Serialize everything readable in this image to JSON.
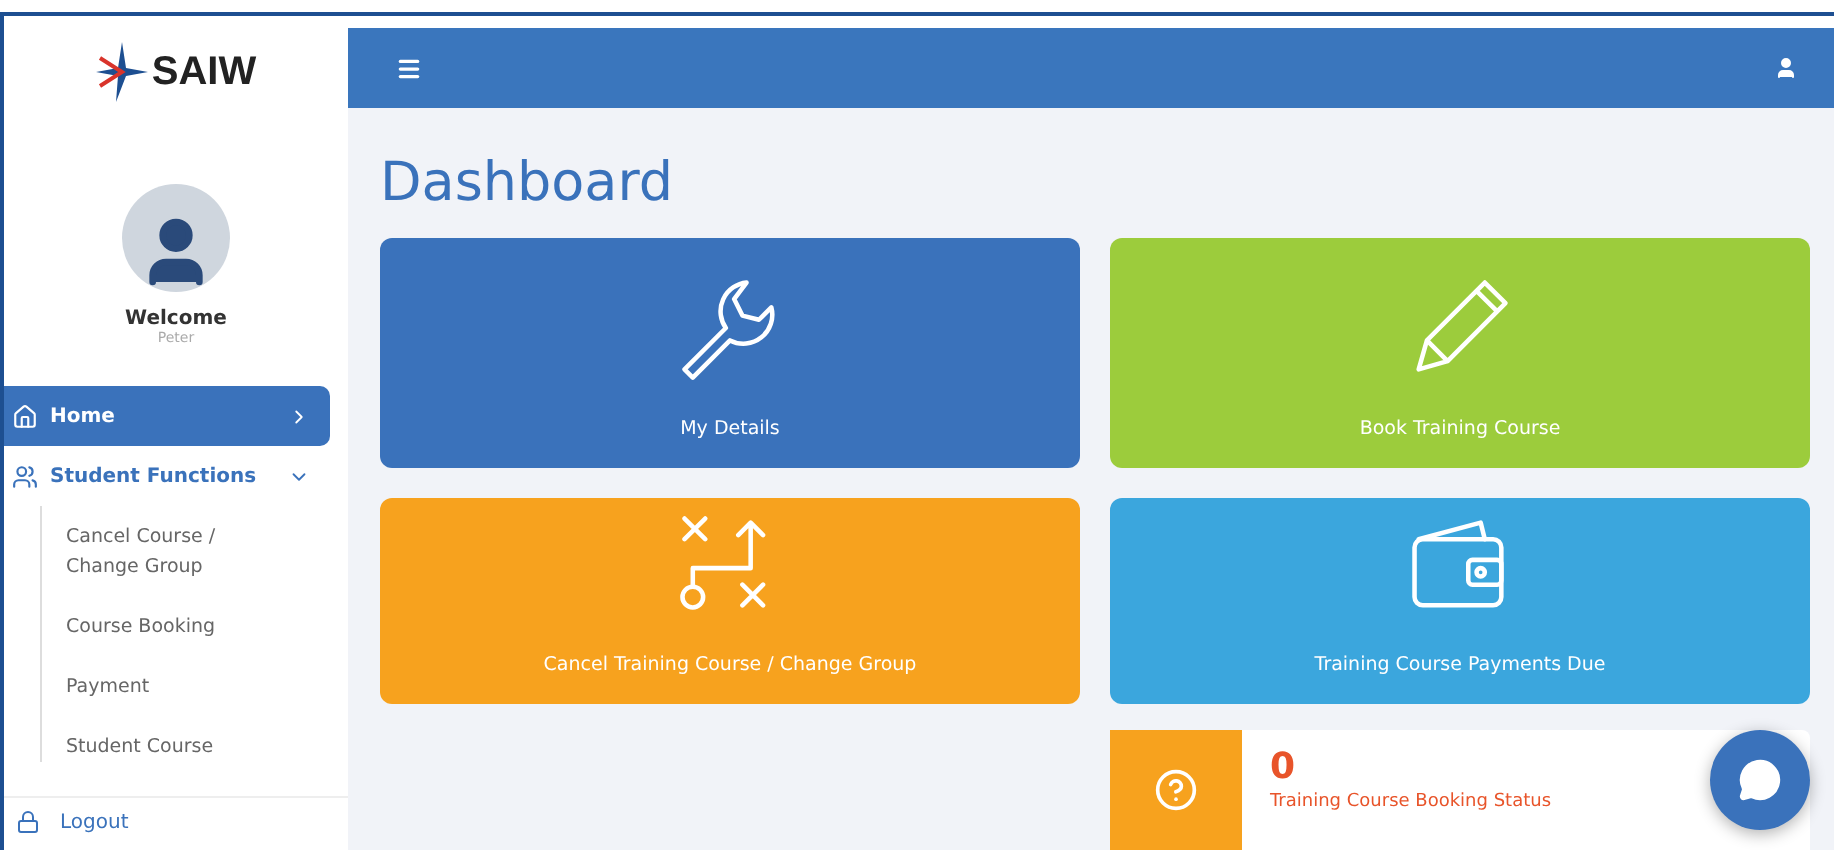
{
  "logo": {
    "text": "SAIW"
  },
  "profile": {
    "greeting": "Welcome",
    "name": "Peter"
  },
  "sidebar": {
    "items": [
      {
        "label": "Home",
        "kind": "link",
        "selected": true
      },
      {
        "label": "Student Functions",
        "kind": "group",
        "selected": false,
        "expanded": true,
        "children": [
          {
            "label": "Cancel Course / Change Group"
          },
          {
            "label": "Course Booking"
          },
          {
            "label": "Payment"
          },
          {
            "label": "Student Course"
          }
        ]
      }
    ],
    "logout": "Logout"
  },
  "page": {
    "title": "Dashboard"
  },
  "tiles": [
    {
      "label": "My Details",
      "kind": "wrench",
      "color": "#3a72bb"
    },
    {
      "label": "Book Training Course",
      "kind": "pencil",
      "color": "#9ccc3c"
    },
    {
      "label": "Cancel Training Course / Change Group",
      "kind": "tactic",
      "color": "#f7a21e"
    },
    {
      "label": "Training Course Payments Due",
      "kind": "wallet",
      "color": "#3ba6dd"
    }
  ],
  "status_card": {
    "count": "0",
    "label": "Training Course Booking Status"
  }
}
